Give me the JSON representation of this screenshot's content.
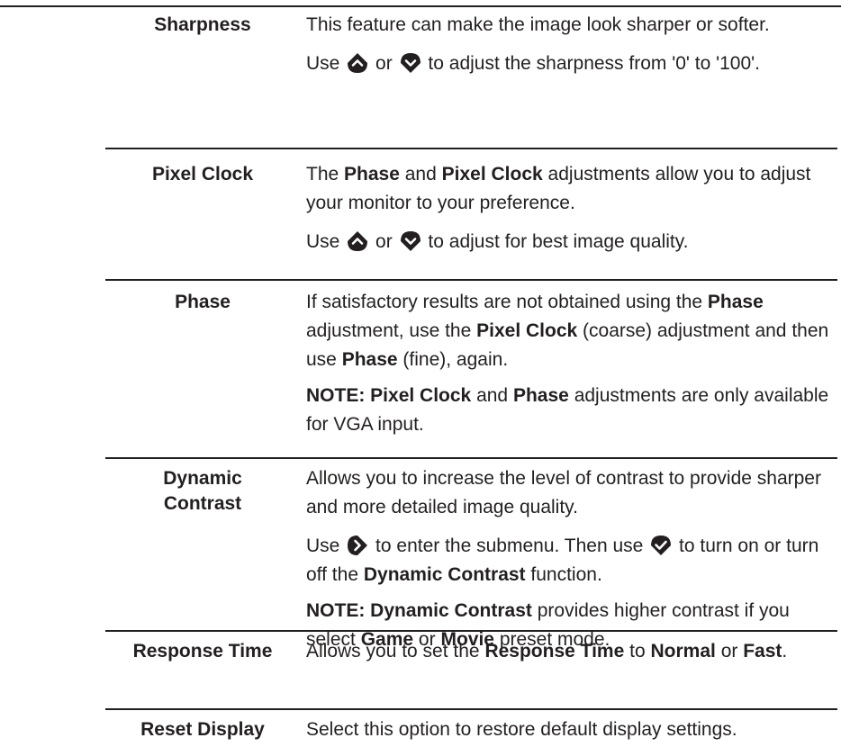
{
  "rows": [
    {
      "label": "Sharpness",
      "p1": "This feature can make the image look sharper or softer.",
      "p2": {
        "a": "Use",
        "b": "or",
        "c": "to adjust the sharpness from '0' to '100'."
      }
    },
    {
      "label": "Pixel Clock",
      "p1": {
        "a": "The",
        "b": "Phase",
        "c": "and",
        "d": "Pixel Clock",
        "e": "adjustments allow you to adjust your monitor to your preference."
      },
      "p2": {
        "a": "Use",
        "b": "or",
        "c": "to adjust for best image quality."
      }
    },
    {
      "label": "Phase",
      "p1": {
        "a": "If satisfactory results are not obtained using the",
        "b": "Phase",
        "c": "adjustment, use the",
        "d": "Pixel Clock",
        "e": "(coarse) adjustment and then use",
        "f": "Phase",
        "g": "(fine), again."
      },
      "note": {
        "a": "NOTE:",
        "b": "Pixel Clock",
        "c": "and",
        "d": "Phase",
        "e": "adjustments are only available for VGA input."
      }
    },
    {
      "label": "Dynamic Contrast",
      "p1": "Allows you to increase the level of contrast to provide sharper and more detailed image quality.",
      "p2": {
        "a": "Use",
        "b": "to enter the submenu. Then use",
        "c": "to turn on or turn off the",
        "d": "Dynamic Contrast",
        "e": "function."
      },
      "note": {
        "a": "NOTE: Dynamic Contrast",
        "b": "provides higher contrast if you select",
        "c": "Game",
        "d": "or",
        "e": "Movie",
        "f": "preset mode."
      }
    },
    {
      "label": "Response Time",
      "p1": {
        "a": "Allows you to set the",
        "b": "Response Time",
        "c": "to",
        "d": "Normal",
        "e": "or",
        "f": "Fast",
        "g": "."
      }
    },
    {
      "label": "Reset Display",
      "p1": "Select this option to restore default display settings."
    }
  ],
  "icons": {
    "up": "chevron-up-icon",
    "down": "chevron-down-icon",
    "right": "chevron-right-icon",
    "check": "check-icon"
  },
  "colors": {
    "text": "#231f20",
    "rule": "#231f20"
  }
}
